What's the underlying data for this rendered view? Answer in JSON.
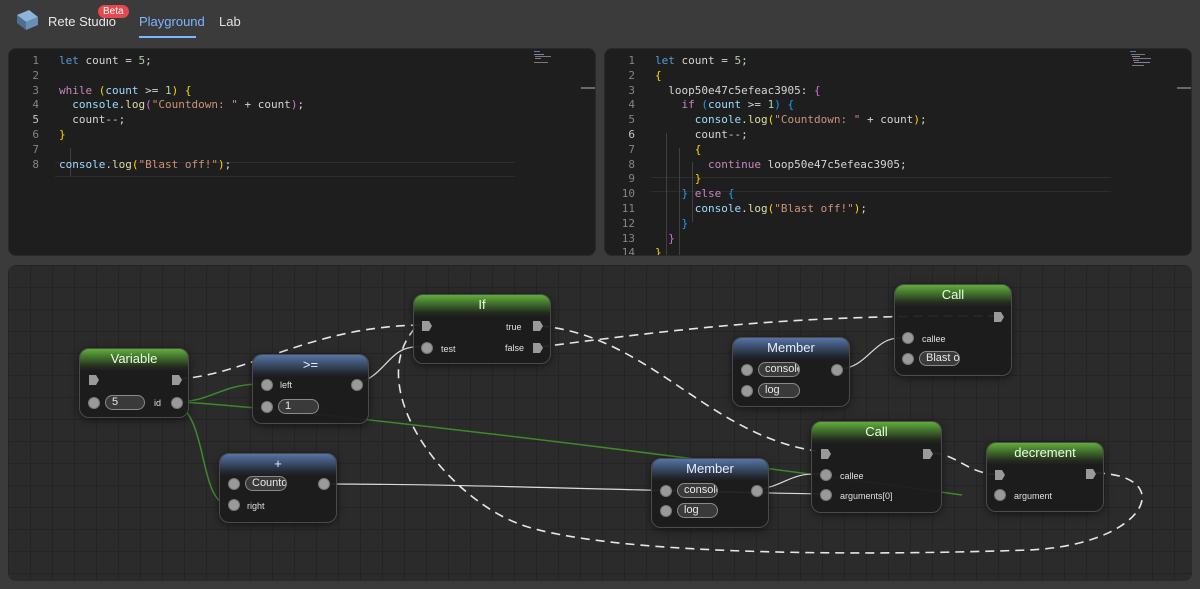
{
  "app": {
    "name": "Rete Studio",
    "badge": "Beta"
  },
  "nav": {
    "playground": "Playground",
    "lab": "Lab"
  },
  "colors": {
    "accent": "#7eb6ff",
    "badge": "#e5484d",
    "green_header": "#5fae3a",
    "blue_header": "#5574a6"
  },
  "left_editor": {
    "lines": [
      {
        "n": "1",
        "tokens": [
          [
            "k",
            "let"
          ],
          [
            "t",
            " count = "
          ],
          [
            "n",
            "5"
          ],
          [
            "t",
            ";"
          ]
        ]
      },
      {
        "n": "2",
        "tokens": []
      },
      {
        "n": "3",
        "tokens": [
          [
            "c",
            "while"
          ],
          [
            "t",
            " "
          ],
          [
            "b1",
            "("
          ],
          [
            "v",
            "count"
          ],
          [
            "t",
            " >= "
          ],
          [
            "n",
            "1"
          ],
          [
            "b1",
            ")"
          ],
          [
            "t",
            " "
          ],
          [
            "b1",
            "{"
          ]
        ]
      },
      {
        "n": "4",
        "tokens": [
          [
            "t",
            "  "
          ],
          [
            "v",
            "console"
          ],
          [
            "t",
            "."
          ],
          [
            "f",
            "log"
          ],
          [
            "b2",
            "("
          ],
          [
            "s",
            "\"Countdown: \""
          ],
          [
            "t",
            " + count"
          ],
          [
            "b2",
            ")"
          ],
          [
            "t",
            ";"
          ]
        ]
      },
      {
        "n": "5",
        "tokens": [
          [
            "t",
            "  count--;"
          ]
        ]
      },
      {
        "n": "6",
        "tokens": [
          [
            "b1",
            "}"
          ]
        ]
      },
      {
        "n": "7",
        "tokens": []
      },
      {
        "n": "8",
        "tokens": [
          [
            "v",
            "console"
          ],
          [
            "t",
            "."
          ],
          [
            "f",
            "log"
          ],
          [
            "b1",
            "("
          ],
          [
            "s",
            "\"Blast off!\""
          ],
          [
            "b1",
            ")"
          ],
          [
            "t",
            ";"
          ]
        ]
      }
    ]
  },
  "right_editor": {
    "lines": [
      {
        "n": "1",
        "tokens": [
          [
            "k",
            "let"
          ],
          [
            "t",
            " count = "
          ],
          [
            "n",
            "5"
          ],
          [
            "t",
            ";"
          ]
        ]
      },
      {
        "n": "2",
        "tokens": [
          [
            "b1",
            "{"
          ]
        ]
      },
      {
        "n": "3",
        "tokens": [
          [
            "t",
            "  loop50e47c5efeac3905: "
          ],
          [
            "b2",
            "{"
          ]
        ]
      },
      {
        "n": "4",
        "tokens": [
          [
            "t",
            "    "
          ],
          [
            "c",
            "if"
          ],
          [
            "t",
            " "
          ],
          [
            "b3",
            "("
          ],
          [
            "v",
            "count"
          ],
          [
            "t",
            " >= "
          ],
          [
            "n",
            "1"
          ],
          [
            "b3",
            ")"
          ],
          [
            "t",
            " "
          ],
          [
            "b3",
            "{"
          ]
        ]
      },
      {
        "n": "5",
        "tokens": [
          [
            "t",
            "      "
          ],
          [
            "v",
            "console"
          ],
          [
            "t",
            "."
          ],
          [
            "f",
            "log"
          ],
          [
            "b1",
            "("
          ],
          [
            "s",
            "\"Countdown: \""
          ],
          [
            "t",
            " + count"
          ],
          [
            "b1",
            ")"
          ],
          [
            "t",
            ";"
          ]
        ]
      },
      {
        "n": "6",
        "tokens": [
          [
            "t",
            "      count--;"
          ]
        ]
      },
      {
        "n": "7",
        "tokens": [
          [
            "t",
            "      "
          ],
          [
            "b1",
            "{"
          ]
        ]
      },
      {
        "n": "8",
        "tokens": [
          [
            "t",
            "        "
          ],
          [
            "c",
            "continue"
          ],
          [
            "t",
            " loop50e47c5efeac3905;"
          ]
        ]
      },
      {
        "n": "9",
        "tokens": [
          [
            "t",
            "      "
          ],
          [
            "b1",
            "}"
          ]
        ]
      },
      {
        "n": "10",
        "tokens": [
          [
            "t",
            "    "
          ],
          [
            "b3",
            "}"
          ],
          [
            "t",
            " "
          ],
          [
            "c",
            "else"
          ],
          [
            "t",
            " "
          ],
          [
            "b3",
            "{"
          ]
        ]
      },
      {
        "n": "11",
        "tokens": [
          [
            "t",
            "      "
          ],
          [
            "v",
            "console"
          ],
          [
            "t",
            "."
          ],
          [
            "f",
            "log"
          ],
          [
            "b1",
            "("
          ],
          [
            "s",
            "\"Blast off!\""
          ],
          [
            "b1",
            ")"
          ],
          [
            "t",
            ";"
          ]
        ]
      },
      {
        "n": "12",
        "tokens": [
          [
            "t",
            "    "
          ],
          [
            "b3",
            "}"
          ]
        ]
      },
      {
        "n": "13",
        "tokens": [
          [
            "t",
            "  "
          ],
          [
            "b2",
            "}"
          ]
        ]
      },
      {
        "n": "14",
        "tokens": [
          [
            "b1",
            "}"
          ]
        ]
      }
    ]
  },
  "nodes": {
    "variable": {
      "title": "Variable",
      "value": "5",
      "port_id": "id"
    },
    "gte": {
      "title": ">=",
      "port_left": "left",
      "port_right_value": "1"
    },
    "plus": {
      "title": "+",
      "value": "Countdown: ",
      "port_right": "right"
    },
    "if": {
      "title": "If",
      "port_true": "true",
      "port_false": "false",
      "port_test": "test"
    },
    "member1": {
      "title": "Member",
      "object": "console",
      "property": "log"
    },
    "member2": {
      "title": "Member",
      "object": "console",
      "property": "log"
    },
    "call1": {
      "title": "Call",
      "port_callee": "callee",
      "argument": "Blast off!"
    },
    "call2": {
      "title": "Call",
      "port_callee": "callee",
      "port_args": "arguments[0]"
    },
    "decrement": {
      "title": "decrement",
      "port_argument": "argument"
    }
  }
}
